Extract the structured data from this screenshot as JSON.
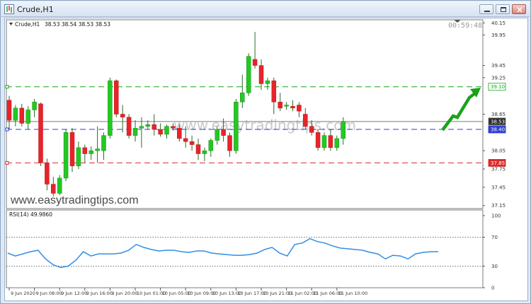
{
  "window": {
    "title": "Crude,H1"
  },
  "icons": {
    "app": "chart-window-icon",
    "minimize": "minimize-icon",
    "restore": "restore-icon",
    "close": "close-icon",
    "scroll_marker": "scroll-marker-icon"
  },
  "chart_header": {
    "symbol_label": "Crude,H1",
    "ohlc": "38.53 38.54 38.53 38.53",
    "countdown": "00:59:48"
  },
  "watermark_main": "www.easytradingtips.com",
  "watermark_center": "www.easytradingtips.com",
  "price_axis": {
    "ticks": [
      "40.15",
      "39.95",
      "39.45",
      "39.25",
      "38.65",
      "38.05",
      "37.75",
      "37.45",
      "37.15"
    ],
    "tick_values": [
      40.15,
      39.95,
      39.45,
      39.25,
      38.65,
      38.05,
      37.75,
      37.45,
      37.15
    ],
    "range": [
      37.1,
      40.2
    ]
  },
  "levels": {
    "resistance": {
      "value": 39.1,
      "label": "39.10",
      "color": "#1aa31a"
    },
    "current": {
      "value": 38.53,
      "label": "38.53",
      "color": "#7a7a7a"
    },
    "middle": {
      "value": 38.4,
      "label": "38.40",
      "color": "#2f3fcf"
    },
    "support": {
      "value": 37.85,
      "label": "37.85",
      "color": "#d92b2b"
    }
  },
  "colors": {
    "bull": "#22c922",
    "bear": "#e8232a",
    "rsi": "#2f8fe6",
    "arrow": "#19a319",
    "grid": "#888888"
  },
  "rsi_panel": {
    "label": "RSI(14) 49.9860",
    "ticks": [
      "100",
      "70",
      "30",
      "0"
    ],
    "tick_values": [
      100,
      70,
      30,
      0
    ]
  },
  "time_axis": {
    "labels": [
      {
        "text": "9 Jun 2020",
        "index": 0
      },
      {
        "text": "9 Jun 08:00",
        "index": 4
      },
      {
        "text": "9 Jun 12:00",
        "index": 8
      },
      {
        "text": "9 Jun 16:00",
        "index": 12
      },
      {
        "text": "9 Jun 20:00",
        "index": 16
      },
      {
        "text": "10 Jun 01:00",
        "index": 20
      },
      {
        "text": "10 Jun 05:00",
        "index": 24
      },
      {
        "text": "10 Jun 09:00",
        "index": 28
      },
      {
        "text": "10 Jun 13:00",
        "index": 32
      },
      {
        "text": "10 Jun 17:00",
        "index": 36
      },
      {
        "text": "10 Jun 21:00",
        "index": 40
      },
      {
        "text": "11 Jun 02:00",
        "index": 44
      },
      {
        "text": "11 Jun 06:00",
        "index": 48
      },
      {
        "text": "11 Jun 10:00",
        "index": 52
      }
    ]
  },
  "chart_data": {
    "type": "candlestick",
    "candles": [
      {
        "o": 38.88,
        "h": 38.95,
        "l": 38.4,
        "c": 38.55
      },
      {
        "o": 38.55,
        "h": 38.8,
        "l": 38.45,
        "c": 38.75
      },
      {
        "o": 38.75,
        "h": 38.82,
        "l": 38.45,
        "c": 38.5
      },
      {
        "o": 38.5,
        "h": 38.78,
        "l": 38.4,
        "c": 38.72
      },
      {
        "o": 38.72,
        "h": 38.9,
        "l": 38.6,
        "c": 38.85
      },
      {
        "o": 38.82,
        "h": 38.84,
        "l": 37.8,
        "c": 37.85
      },
      {
        "o": 37.85,
        "h": 37.92,
        "l": 37.4,
        "c": 37.5
      },
      {
        "o": 37.5,
        "h": 37.62,
        "l": 37.3,
        "c": 37.35
      },
      {
        "o": 37.35,
        "h": 37.65,
        "l": 37.32,
        "c": 37.6
      },
      {
        "o": 37.6,
        "h": 38.4,
        "l": 37.55,
        "c": 38.35
      },
      {
        "o": 38.35,
        "h": 38.42,
        "l": 37.7,
        "c": 37.8
      },
      {
        "o": 37.8,
        "h": 38.2,
        "l": 37.75,
        "c": 38.1
      },
      {
        "o": 38.1,
        "h": 38.15,
        "l": 37.85,
        "c": 38.0
      },
      {
        "o": 38.0,
        "h": 38.12,
        "l": 37.9,
        "c": 38.05
      },
      {
        "o": 38.05,
        "h": 38.45,
        "l": 37.85,
        "c": 38.08
      },
      {
        "o": 38.05,
        "h": 38.35,
        "l": 37.9,
        "c": 38.3
      },
      {
        "o": 38.3,
        "h": 39.25,
        "l": 38.25,
        "c": 39.2
      },
      {
        "o": 39.2,
        "h": 39.22,
        "l": 38.6,
        "c": 38.65
      },
      {
        "o": 38.65,
        "h": 38.8,
        "l": 38.35,
        "c": 38.6
      },
      {
        "o": 38.6,
        "h": 38.65,
        "l": 38.25,
        "c": 38.3
      },
      {
        "o": 38.3,
        "h": 38.55,
        "l": 38.2,
        "c": 38.42
      },
      {
        "o": 38.42,
        "h": 38.6,
        "l": 38.1,
        "c": 38.45
      },
      {
        "o": 38.45,
        "h": 38.55,
        "l": 38.4,
        "c": 38.48
      },
      {
        "o": 38.48,
        "h": 38.65,
        "l": 38.3,
        "c": 38.4
      },
      {
        "o": 38.4,
        "h": 38.5,
        "l": 38.28,
        "c": 38.32
      },
      {
        "o": 38.32,
        "h": 38.48,
        "l": 38.25,
        "c": 38.45
      },
      {
        "o": 38.45,
        "h": 38.5,
        "l": 38.38,
        "c": 38.42
      },
      {
        "o": 38.42,
        "h": 38.48,
        "l": 38.2,
        "c": 38.25
      },
      {
        "o": 38.25,
        "h": 38.45,
        "l": 38.1,
        "c": 38.2
      },
      {
        "o": 38.2,
        "h": 38.3,
        "l": 38.05,
        "c": 38.15
      },
      {
        "o": 38.15,
        "h": 38.25,
        "l": 37.9,
        "c": 38.0
      },
      {
        "o": 38.0,
        "h": 38.1,
        "l": 37.88,
        "c": 38.05
      },
      {
        "o": 38.05,
        "h": 38.25,
        "l": 37.95,
        "c": 38.22
      },
      {
        "o": 38.22,
        "h": 38.45,
        "l": 38.15,
        "c": 38.4
      },
      {
        "o": 38.4,
        "h": 38.58,
        "l": 38.2,
        "c": 38.3
      },
      {
        "o": 38.3,
        "h": 38.35,
        "l": 37.95,
        "c": 38.05
      },
      {
        "o": 38.05,
        "h": 38.9,
        "l": 38.0,
        "c": 38.85
      },
      {
        "o": 38.85,
        "h": 39.3,
        "l": 38.75,
        "c": 39.0
      },
      {
        "o": 39.0,
        "h": 39.65,
        "l": 38.95,
        "c": 39.6
      },
      {
        "o": 39.55,
        "h": 40.0,
        "l": 39.4,
        "c": 39.45
      },
      {
        "o": 39.45,
        "h": 39.55,
        "l": 39.05,
        "c": 39.15
      },
      {
        "o": 39.15,
        "h": 39.25,
        "l": 39.05,
        "c": 39.2
      },
      {
        "o": 39.2,
        "h": 39.25,
        "l": 38.65,
        "c": 38.85
      },
      {
        "o": 38.85,
        "h": 39.0,
        "l": 38.7,
        "c": 38.75
      },
      {
        "o": 38.78,
        "h": 38.85,
        "l": 38.72,
        "c": 38.8
      },
      {
        "o": 38.78,
        "h": 38.88,
        "l": 38.7,
        "c": 38.75
      },
      {
        "o": 38.8,
        "h": 38.85,
        "l": 38.6,
        "c": 38.7
      },
      {
        "o": 38.65,
        "h": 38.75,
        "l": 38.4,
        "c": 38.45
      },
      {
        "o": 38.45,
        "h": 38.55,
        "l": 38.3,
        "c": 38.35
      },
      {
        "o": 38.35,
        "h": 38.4,
        "l": 38.05,
        "c": 38.1
      },
      {
        "o": 38.1,
        "h": 38.35,
        "l": 38.05,
        "c": 38.3
      },
      {
        "o": 38.3,
        "h": 38.4,
        "l": 38.05,
        "c": 38.1
      },
      {
        "o": 38.1,
        "h": 38.3,
        "l": 38.05,
        "c": 38.25
      },
      {
        "o": 38.25,
        "h": 38.6,
        "l": 38.15,
        "c": 38.53
      }
    ],
    "rsi": [
      48,
      44,
      47,
      50,
      52,
      40,
      32,
      28,
      30,
      38,
      50,
      44,
      47,
      47,
      47,
      48,
      52,
      60,
      56,
      53,
      51,
      52,
      52,
      50,
      49,
      51,
      51,
      48,
      47,
      46,
      45,
      45,
      46,
      48,
      53,
      56,
      48,
      44,
      60,
      62,
      68,
      64,
      62,
      58,
      55,
      54,
      53,
      52,
      49,
      47,
      40,
      45,
      44,
      40,
      47,
      49,
      50,
      50
    ],
    "ylim": [
      37.1,
      40.2
    ],
    "rsi_levels": [
      70,
      30
    ]
  }
}
